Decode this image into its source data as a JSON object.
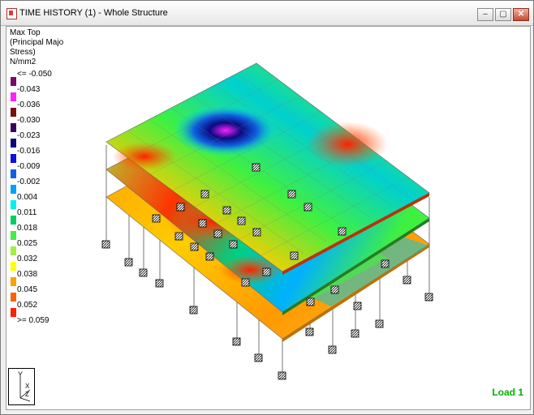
{
  "window": {
    "title": "TIME HISTORY (1) - Whole Structure",
    "buttons": {
      "minimize": "–",
      "maximize": "▢",
      "close": "✕"
    }
  },
  "legend": {
    "title_lines": [
      "Max Top",
      "(Principal Majo",
      "Stress)",
      "N/mm2"
    ],
    "items": [
      {
        "label": "<= -0.050",
        "color": "#7a0a6a"
      },
      {
        "label": "-0.043",
        "color": "#ff20ff"
      },
      {
        "label": "-0.036",
        "color": "#7a1010"
      },
      {
        "label": "-0.030",
        "color": "#3a0060"
      },
      {
        "label": "-0.023",
        "color": "#0a0a80"
      },
      {
        "label": "-0.016",
        "color": "#1010e0"
      },
      {
        "label": "-0.009",
        "color": "#1060e0"
      },
      {
        "label": "-0.002",
        "color": "#00a0ff"
      },
      {
        "label": "0.004",
        "color": "#00f0f0"
      },
      {
        "label": "0.011",
        "color": "#00d060"
      },
      {
        "label": "0.018",
        "color": "#40f040"
      },
      {
        "label": "0.025",
        "color": "#a0f040"
      },
      {
        "label": "0.032",
        "color": "#ffff00"
      },
      {
        "label": "0.038",
        "color": "#ffa000"
      },
      {
        "label": "0.045",
        "color": "#ff6000"
      },
      {
        "label": "0.052",
        "color": "#ff2000"
      }
    ],
    "last_label": ">= 0.059"
  },
  "axis": {
    "y": "Y",
    "x": "X",
    "z": "Z"
  },
  "status": {
    "load_case": "Load 1"
  }
}
